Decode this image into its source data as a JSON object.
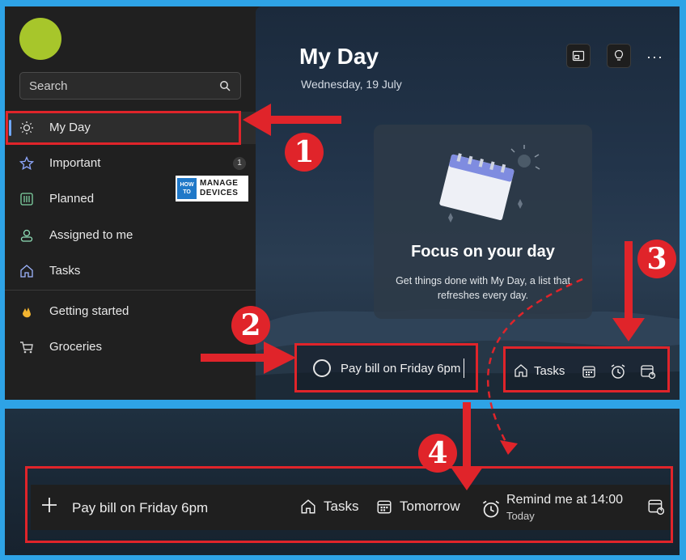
{
  "sidebar": {
    "search_placeholder": "Search",
    "items": [
      {
        "label": "My Day",
        "icon": "sun-icon"
      },
      {
        "label": "Important",
        "icon": "star-icon",
        "count": "1"
      },
      {
        "label": "Planned",
        "icon": "calendar-grid-icon"
      },
      {
        "label": "Assigned to me",
        "icon": "person-icon"
      },
      {
        "label": "Tasks",
        "icon": "home-icon"
      },
      {
        "label": "Getting started",
        "icon": "wave-hand-icon"
      },
      {
        "label": "Groceries",
        "icon": "cart-icon"
      }
    ]
  },
  "watermark": {
    "line1": "HOW TO",
    "line2": "MANAGE",
    "line3": "DEVICES"
  },
  "main": {
    "title": "My Day",
    "date": "Wednesday, 19 July",
    "more": "···",
    "focus_title": "Focus on your day",
    "focus_desc": "Get things done with My Day, a list that refreshes every day."
  },
  "add_task": {
    "value": "Pay bill on Friday 6pm"
  },
  "task_tools": {
    "list_label": "Tasks"
  },
  "bottom": {
    "task_text": "Pay bill on Friday  6pm",
    "list_label": "Tasks",
    "due_label": "Tomorrow",
    "remind_label": "Remind me at 14:00",
    "remind_sub": "Today"
  },
  "annotations": {
    "n1": "1",
    "n2": "2",
    "n3": "3",
    "n4": "4"
  },
  "colors": {
    "accent_red": "#e0242a",
    "frame_blue": "#2ea3e6",
    "avatar": "#a7c62b"
  }
}
